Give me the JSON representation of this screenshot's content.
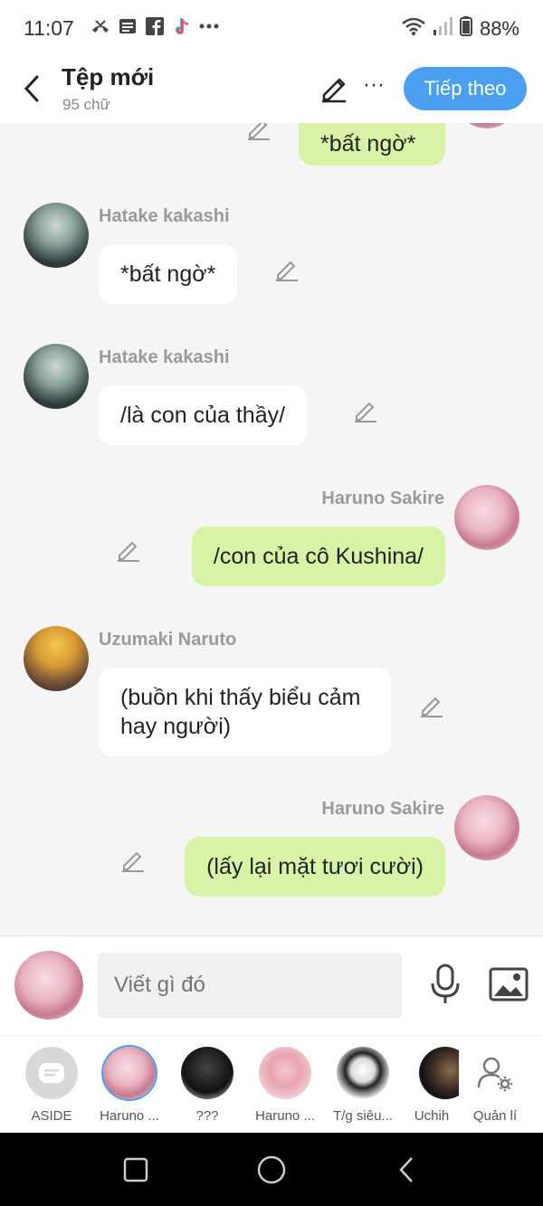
{
  "status_bar": {
    "time": "11:07",
    "battery": "88%",
    "left_icons": [
      "missed-call-icon",
      "message-icon",
      "facebook-icon",
      "tiktok-icon",
      "more-dots-icon"
    ],
    "right_icons": [
      "wifi-icon",
      "signal-icon",
      "battery-icon"
    ]
  },
  "header": {
    "title": "Tệp mới",
    "subtitle": "95 chữ",
    "next_label": "Tiếp theo",
    "more_label": "···"
  },
  "messages": [
    {
      "side": "right",
      "name": "",
      "text": "*bất ngờ*",
      "avatar": "sakura"
    },
    {
      "side": "left",
      "name": "Hatake kakashi",
      "text": "*bất ngờ*",
      "avatar": "kakashi"
    },
    {
      "side": "left",
      "name": "Hatake kakashi",
      "text": "/là con của thầy/",
      "avatar": "kakashi"
    },
    {
      "side": "right",
      "name": "Haruno Sakire",
      "text": "/con của cô Kushina/",
      "avatar": "sakura"
    },
    {
      "side": "left",
      "name": "Uzumaki Naruto",
      "text": "(buồn khi thấy biểu cảm hay người)",
      "avatar": "naruto"
    },
    {
      "side": "right",
      "name": "Haruno Sakire",
      "text": "(lấy lại mặt tươi cười)",
      "avatar": "sakura"
    }
  ],
  "compose": {
    "placeholder": "Viết gì đó"
  },
  "characters": [
    {
      "label": "ASIDE"
    },
    {
      "label": "Haruno ..."
    },
    {
      "label": "???"
    },
    {
      "label": "Haruno ..."
    },
    {
      "label": "T/g siêu..."
    },
    {
      "label": "Uchih"
    },
    {
      "label": "Quản lí"
    }
  ],
  "colors": {
    "accent": "#4a9ff0",
    "green_bubble": "#d9f3a6",
    "white_bubble": "#ffffff",
    "chat_bg": "#f5f5f5"
  }
}
